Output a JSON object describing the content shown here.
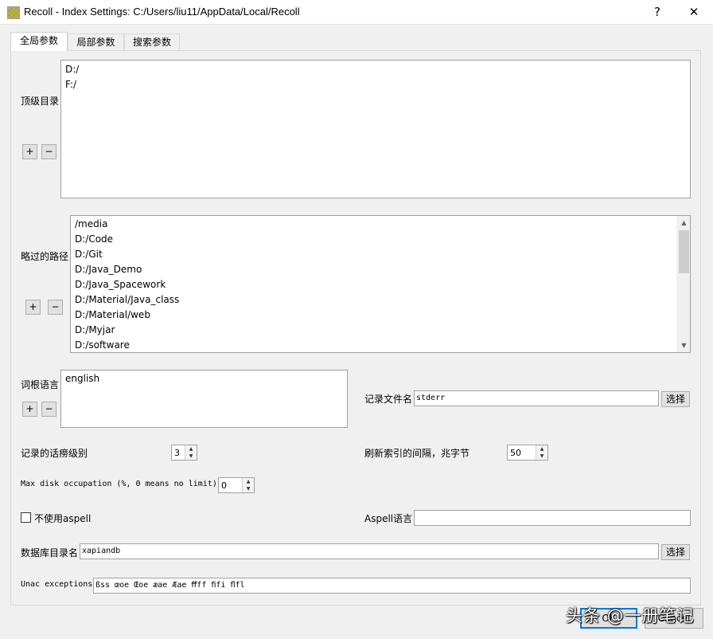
{
  "window": {
    "title": "Recoll - Index Settings: C:/Users/liu11/AppData/Local/Recoll",
    "help_glyph": "?",
    "close_glyph": "✕"
  },
  "tabs": [
    {
      "label": "全局参数",
      "active": true
    },
    {
      "label": "局部参数",
      "active": false
    },
    {
      "label": "搜索参数",
      "active": false
    }
  ],
  "topdirs": {
    "label": "顶级目录",
    "items": [
      "D:/",
      "F:/"
    ],
    "add_label": "+",
    "remove_label": "−"
  },
  "skipped_paths": {
    "label": "略过的路径",
    "items": [
      "/media",
      "D:/Code",
      "D:/Git",
      "D:/Java_Demo",
      "D:/Java_Spacework",
      "D:/Material/Java_class",
      "D:/Material/web",
      "D:/Myjar",
      "D:/software"
    ],
    "add_label": "+",
    "remove_label": "−"
  },
  "stemming": {
    "label": "词根语言",
    "items": [
      "english"
    ],
    "add_label": "+",
    "remove_label": "−"
  },
  "log_file": {
    "label": "记录文件名",
    "value": "stderr",
    "choose_label": "选择"
  },
  "log_verbosity": {
    "label": "记录的话痨级别",
    "value": "3"
  },
  "flush_interval": {
    "label": "刷新索引的间隔，兆字节",
    "value": "50"
  },
  "max_disk": {
    "label": "Max disk occupation (%, 0 means no limit)",
    "value": "0"
  },
  "no_aspell": {
    "label": "不使用aspell",
    "checked": false
  },
  "aspell_language": {
    "label": "Aspell语言",
    "value": ""
  },
  "db_dir": {
    "label": "数据库目录名",
    "value": "xapiandb",
    "choose_label": "选择"
  },
  "unac": {
    "label": "Unac exceptions",
    "value": "ßss œoe Œoe æae Æae ﬀff ﬁfi ﬂfl"
  },
  "dialog": {
    "ok_label": "OK",
    "cancel_label": "Cancel"
  },
  "watermark": "头条 @一册笔记"
}
